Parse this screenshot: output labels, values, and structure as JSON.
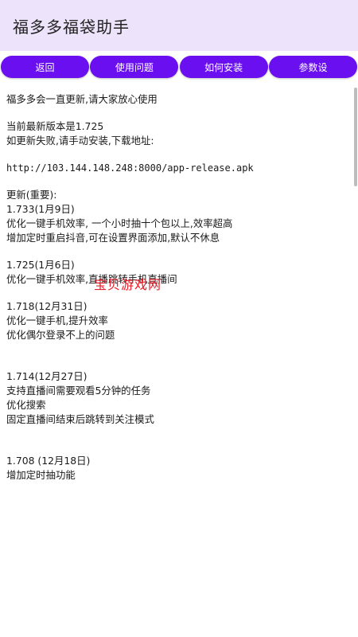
{
  "app_bar": {
    "title": "福多多福袋助手"
  },
  "buttons": [
    {
      "label": "返回"
    },
    {
      "label": "使用问题"
    },
    {
      "label": "如何安装"
    },
    {
      "label": "参数设"
    }
  ],
  "content": {
    "intro": "福多多会一直更新,请大家放心使用",
    "version_line": "当前最新版本是1.725",
    "fail_line": "如更新失败,请手动安装,下载地址:",
    "url": "http://103.144.148.248:8000/app-release.apk",
    "update_header": "更新(重要):",
    "releases": [
      {
        "version": "1.733(1月9日)",
        "notes": [
          "优化一键手机效率, 一个小时抽十个包以上,效率超高",
          "增加定时重启抖音,可在设置界面添加,默认不休息"
        ]
      },
      {
        "version": "1.725(1月6日)",
        "notes": [
          "优化一键手机效率,直播跳转手机直播间"
        ]
      },
      {
        "version": "1.718(12月31日)",
        "notes": [
          "优化一键手机,提升效率",
          "优化偶尔登录不上的问题"
        ]
      },
      {
        "version": "1.714(12月27日)",
        "notes": [
          "支持直播间需要观看5分钟的任务",
          "优化搜索",
          "固定直播间结束后跳转到关注模式"
        ]
      },
      {
        "version": "1.708 (12月18日)",
        "notes": [
          "增加定时抽功能"
        ]
      }
    ]
  },
  "watermark": "宝贝游戏网"
}
